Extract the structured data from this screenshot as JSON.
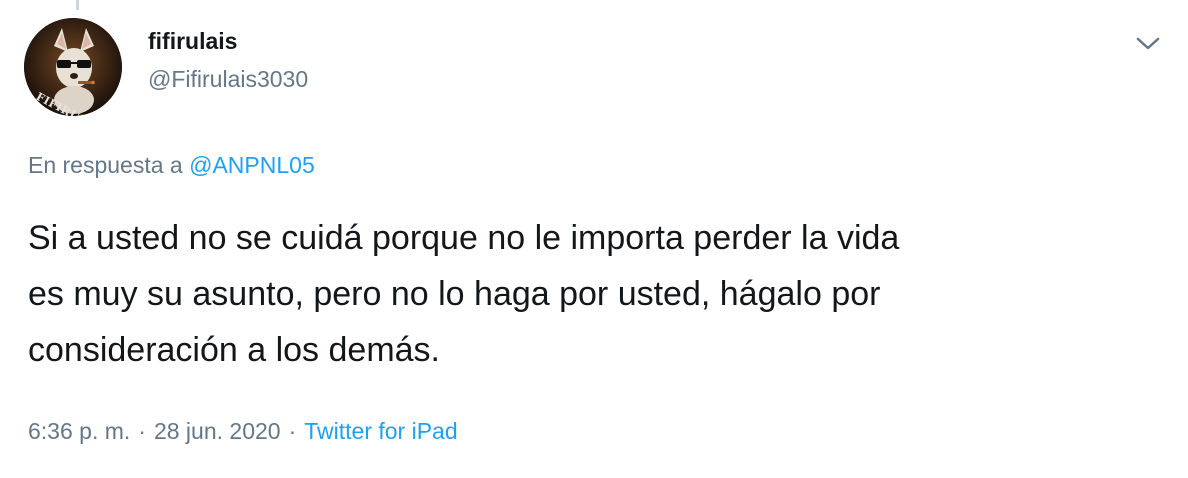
{
  "tweet": {
    "author": {
      "display_name": "fifirulais",
      "handle": "@Fifirulais3030",
      "avatar_text": "FIFIRULAIS"
    },
    "reply": {
      "prefix": "En respuesta a",
      "mention": "@ANPNL05"
    },
    "text": "Si a usted no se cuidá porque no le importa perder la vida\nes muy su asunto, pero no lo haga por usted, hágalo por\nconsideración a los demás.",
    "meta": {
      "time": "6:36 p. m.",
      "date": "28 jun. 2020",
      "separator": "·",
      "source": "Twitter for iPad"
    },
    "icons": {
      "more": "chevron-down-icon"
    },
    "colors": {
      "accent": "#1da1f2",
      "secondary_text": "#657786",
      "primary_text": "#14171a"
    }
  }
}
